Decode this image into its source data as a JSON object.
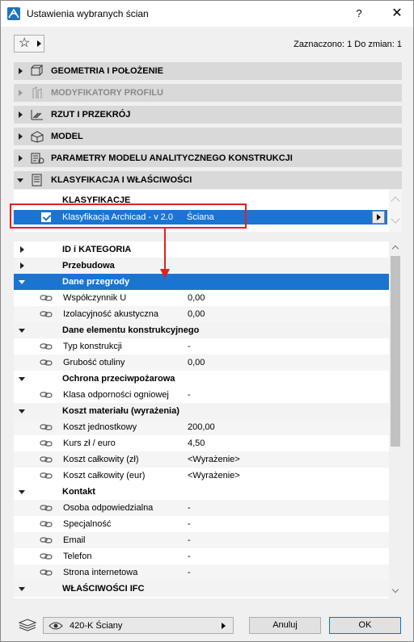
{
  "window": {
    "title": "Ustawienia wybranych ścian",
    "help_label": "?",
    "close_label": "✕"
  },
  "toolbar": {
    "favorites_icon": "star-icon",
    "selected_info": "Zaznaczono: 1 Do zmian: 1"
  },
  "panels": [
    {
      "label": "GEOMETRIA I POŁOŻENIE",
      "icon": "geometry-icon",
      "expanded": false,
      "enabled": true
    },
    {
      "label": "MODYFIKATORY PROFILU",
      "icon": "profile-modifier-icon",
      "expanded": false,
      "enabled": false
    },
    {
      "label": "RZUT I PRZEKRÓJ",
      "icon": "floor-plan-icon",
      "expanded": false,
      "enabled": true
    },
    {
      "label": "MODEL",
      "icon": "model-icon",
      "expanded": false,
      "enabled": true
    },
    {
      "label": "PARAMETRY MODELU ANALITYCZNEGO KONSTRUKCJI",
      "icon": "structural-analytical-icon",
      "expanded": false,
      "enabled": true
    },
    {
      "label": "KLASYFIKACJA I WŁAŚCIWOŚCI",
      "icon": "classification-icon",
      "expanded": true,
      "enabled": true
    }
  ],
  "classification": {
    "header": "KLASYFIKACJE",
    "row": {
      "system": "Klasyfikacja Archicad - v 2.0",
      "value": "Ściana",
      "checked": true
    }
  },
  "properties": [
    {
      "type": "group",
      "label": "ID i KATEGORIA",
      "expanded": false
    },
    {
      "type": "group",
      "label": "Przebudowa",
      "expanded": false
    },
    {
      "type": "group",
      "label": "Dane przegrody",
      "expanded": true,
      "selected": true
    },
    {
      "type": "item",
      "label": "Współczynnik U",
      "value": "0,00"
    },
    {
      "type": "item",
      "label": "Izolacyjność akustyczna",
      "value": "0,00"
    },
    {
      "type": "group",
      "label": "Dane elementu konstrukcyjnego",
      "expanded": true
    },
    {
      "type": "item",
      "label": "Typ konstrukcji",
      "value": "-"
    },
    {
      "type": "item",
      "label": "Grubość otuliny",
      "value": "0,00"
    },
    {
      "type": "group",
      "label": "Ochrona przeciwpożarowa",
      "expanded": true
    },
    {
      "type": "item",
      "label": "Klasa odporności ogniowej",
      "value": "-"
    },
    {
      "type": "group",
      "label": "Koszt materiału (wyrażenia)",
      "expanded": true
    },
    {
      "type": "item",
      "label": "Koszt jednostkowy",
      "value": "200,00"
    },
    {
      "type": "item",
      "label": "Kurs zł / euro",
      "value": "4,50"
    },
    {
      "type": "item",
      "label": "Koszt całkowity (zł)",
      "value": "<Wyrażenie>"
    },
    {
      "type": "item",
      "label": "Koszt całkowity (eur)",
      "value": "<Wyrażenie>"
    },
    {
      "type": "group",
      "label": "Kontakt",
      "expanded": true
    },
    {
      "type": "item",
      "label": "Osoba odpowiedzialna",
      "value": "-"
    },
    {
      "type": "item",
      "label": "Specjalność",
      "value": "-"
    },
    {
      "type": "item",
      "label": "Email",
      "value": "-"
    },
    {
      "type": "item",
      "label": "Telefon",
      "value": "-"
    },
    {
      "type": "item",
      "label": "Strona internetowa",
      "value": "-"
    },
    {
      "type": "group",
      "label": "WŁAŚCIWOŚCI IFC",
      "expanded": true
    }
  ],
  "footer": {
    "layer_value": "420-K Ściany",
    "cancel_label": "Anuluj",
    "ok_label": "OK"
  },
  "colors": {
    "selection": "#1a75d2",
    "highlight_box": "#e02020",
    "panel_header": "#d9d9d9"
  }
}
